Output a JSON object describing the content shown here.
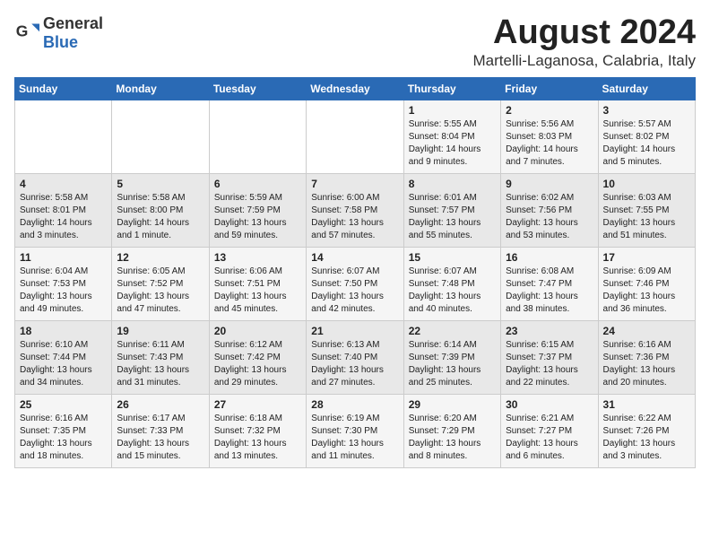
{
  "logo": {
    "text_general": "General",
    "text_blue": "Blue"
  },
  "title": {
    "month_year": "August 2024",
    "location": "Martelli-Laganosa, Calabria, Italy"
  },
  "headers": [
    "Sunday",
    "Monday",
    "Tuesday",
    "Wednesday",
    "Thursday",
    "Friday",
    "Saturday"
  ],
  "weeks": [
    [
      {
        "day": "",
        "info": ""
      },
      {
        "day": "",
        "info": ""
      },
      {
        "day": "",
        "info": ""
      },
      {
        "day": "",
        "info": ""
      },
      {
        "day": "1",
        "info": "Sunrise: 5:55 AM\nSunset: 8:04 PM\nDaylight: 14 hours\nand 9 minutes."
      },
      {
        "day": "2",
        "info": "Sunrise: 5:56 AM\nSunset: 8:03 PM\nDaylight: 14 hours\nand 7 minutes."
      },
      {
        "day": "3",
        "info": "Sunrise: 5:57 AM\nSunset: 8:02 PM\nDaylight: 14 hours\nand 5 minutes."
      }
    ],
    [
      {
        "day": "4",
        "info": "Sunrise: 5:58 AM\nSunset: 8:01 PM\nDaylight: 14 hours\nand 3 minutes."
      },
      {
        "day": "5",
        "info": "Sunrise: 5:58 AM\nSunset: 8:00 PM\nDaylight: 14 hours\nand 1 minute."
      },
      {
        "day": "6",
        "info": "Sunrise: 5:59 AM\nSunset: 7:59 PM\nDaylight: 13 hours\nand 59 minutes."
      },
      {
        "day": "7",
        "info": "Sunrise: 6:00 AM\nSunset: 7:58 PM\nDaylight: 13 hours\nand 57 minutes."
      },
      {
        "day": "8",
        "info": "Sunrise: 6:01 AM\nSunset: 7:57 PM\nDaylight: 13 hours\nand 55 minutes."
      },
      {
        "day": "9",
        "info": "Sunrise: 6:02 AM\nSunset: 7:56 PM\nDaylight: 13 hours\nand 53 minutes."
      },
      {
        "day": "10",
        "info": "Sunrise: 6:03 AM\nSunset: 7:55 PM\nDaylight: 13 hours\nand 51 minutes."
      }
    ],
    [
      {
        "day": "11",
        "info": "Sunrise: 6:04 AM\nSunset: 7:53 PM\nDaylight: 13 hours\nand 49 minutes."
      },
      {
        "day": "12",
        "info": "Sunrise: 6:05 AM\nSunset: 7:52 PM\nDaylight: 13 hours\nand 47 minutes."
      },
      {
        "day": "13",
        "info": "Sunrise: 6:06 AM\nSunset: 7:51 PM\nDaylight: 13 hours\nand 45 minutes."
      },
      {
        "day": "14",
        "info": "Sunrise: 6:07 AM\nSunset: 7:50 PM\nDaylight: 13 hours\nand 42 minutes."
      },
      {
        "day": "15",
        "info": "Sunrise: 6:07 AM\nSunset: 7:48 PM\nDaylight: 13 hours\nand 40 minutes."
      },
      {
        "day": "16",
        "info": "Sunrise: 6:08 AM\nSunset: 7:47 PM\nDaylight: 13 hours\nand 38 minutes."
      },
      {
        "day": "17",
        "info": "Sunrise: 6:09 AM\nSunset: 7:46 PM\nDaylight: 13 hours\nand 36 minutes."
      }
    ],
    [
      {
        "day": "18",
        "info": "Sunrise: 6:10 AM\nSunset: 7:44 PM\nDaylight: 13 hours\nand 34 minutes."
      },
      {
        "day": "19",
        "info": "Sunrise: 6:11 AM\nSunset: 7:43 PM\nDaylight: 13 hours\nand 31 minutes."
      },
      {
        "day": "20",
        "info": "Sunrise: 6:12 AM\nSunset: 7:42 PM\nDaylight: 13 hours\nand 29 minutes."
      },
      {
        "day": "21",
        "info": "Sunrise: 6:13 AM\nSunset: 7:40 PM\nDaylight: 13 hours\nand 27 minutes."
      },
      {
        "day": "22",
        "info": "Sunrise: 6:14 AM\nSunset: 7:39 PM\nDaylight: 13 hours\nand 25 minutes."
      },
      {
        "day": "23",
        "info": "Sunrise: 6:15 AM\nSunset: 7:37 PM\nDaylight: 13 hours\nand 22 minutes."
      },
      {
        "day": "24",
        "info": "Sunrise: 6:16 AM\nSunset: 7:36 PM\nDaylight: 13 hours\nand 20 minutes."
      }
    ],
    [
      {
        "day": "25",
        "info": "Sunrise: 6:16 AM\nSunset: 7:35 PM\nDaylight: 13 hours\nand 18 minutes."
      },
      {
        "day": "26",
        "info": "Sunrise: 6:17 AM\nSunset: 7:33 PM\nDaylight: 13 hours\nand 15 minutes."
      },
      {
        "day": "27",
        "info": "Sunrise: 6:18 AM\nSunset: 7:32 PM\nDaylight: 13 hours\nand 13 minutes."
      },
      {
        "day": "28",
        "info": "Sunrise: 6:19 AM\nSunset: 7:30 PM\nDaylight: 13 hours\nand 11 minutes."
      },
      {
        "day": "29",
        "info": "Sunrise: 6:20 AM\nSunset: 7:29 PM\nDaylight: 13 hours\nand 8 minutes."
      },
      {
        "day": "30",
        "info": "Sunrise: 6:21 AM\nSunset: 7:27 PM\nDaylight: 13 hours\nand 6 minutes."
      },
      {
        "day": "31",
        "info": "Sunrise: 6:22 AM\nSunset: 7:26 PM\nDaylight: 13 hours\nand 3 minutes."
      }
    ]
  ]
}
